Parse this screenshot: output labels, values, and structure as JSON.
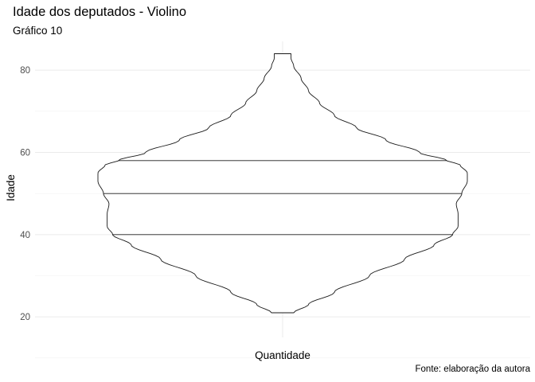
{
  "chart_data": {
    "type": "violin",
    "title": "Idade dos deputados - Violino",
    "subtitle": "Gráfico 10",
    "caption": "Fonte: elaboração da autora",
    "xlabel": "Quantidade",
    "ylabel": "Idade",
    "categories": [
      "Quantidade"
    ],
    "ylim": [
      15,
      87
    ],
    "y_ticks": [
      20,
      40,
      60,
      80
    ],
    "grid": true,
    "range": [
      21,
      84
    ],
    "quantiles": [
      40,
      50,
      58
    ],
    "density_profile": [
      {
        "y": 21,
        "w": 0.06
      },
      {
        "y": 23,
        "w": 0.14
      },
      {
        "y": 26,
        "w": 0.28
      },
      {
        "y": 30,
        "w": 0.47
      },
      {
        "y": 34,
        "w": 0.66
      },
      {
        "y": 37.5,
        "w": 0.82
      },
      {
        "y": 40,
        "w": 0.92
      },
      {
        "y": 42,
        "w": 0.95
      },
      {
        "y": 45,
        "w": 0.95
      },
      {
        "y": 47.5,
        "w": 0.94
      },
      {
        "y": 50,
        "w": 0.97
      },
      {
        "y": 53,
        "w": 1.0
      },
      {
        "y": 55,
        "w": 1.0
      },
      {
        "y": 57,
        "w": 0.96
      },
      {
        "y": 58,
        "w": 0.89
      },
      {
        "y": 60,
        "w": 0.74
      },
      {
        "y": 63,
        "w": 0.56
      },
      {
        "y": 66,
        "w": 0.4
      },
      {
        "y": 69,
        "w": 0.28
      },
      {
        "y": 72,
        "w": 0.2
      },
      {
        "y": 75,
        "w": 0.14
      },
      {
        "y": 78,
        "w": 0.1
      },
      {
        "y": 81,
        "w": 0.06
      },
      {
        "y": 83,
        "w": 0.045
      },
      {
        "y": 84,
        "w": 0.045
      }
    ]
  }
}
